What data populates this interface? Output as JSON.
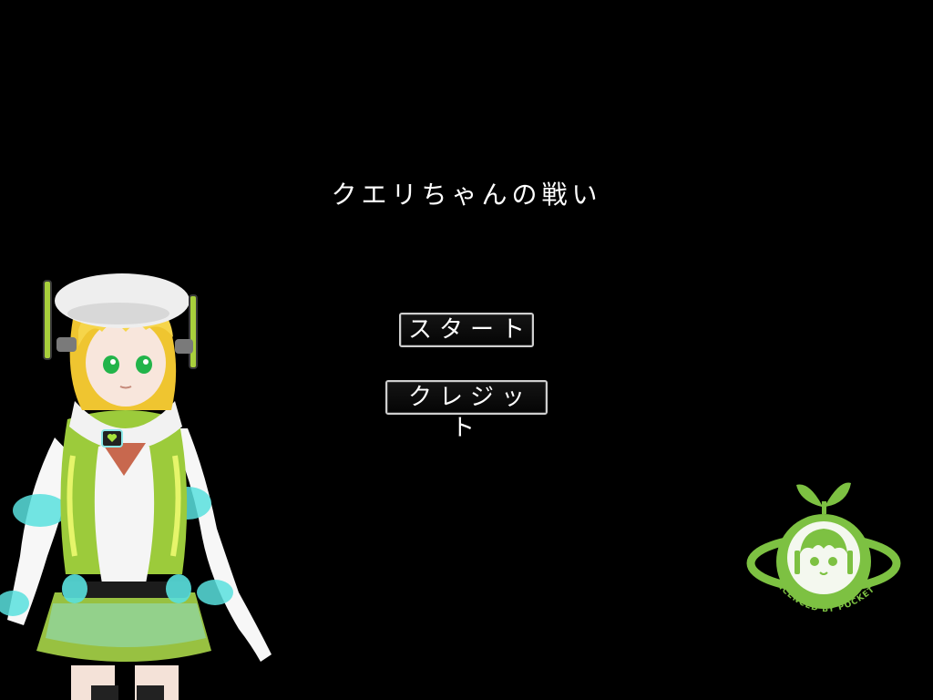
{
  "game": {
    "title": "クエリちゃんの戦い"
  },
  "menu": {
    "start_label": "スタート",
    "credit_label": "クレジット"
  },
  "logo": {
    "text": "LICENCED BY POCKET QUERIES",
    "color": "#7dc142"
  },
  "character": {
    "hair_color": "#f6d54a",
    "outfit_color": "#9ccb3b",
    "accent_color": "#5fe6e6"
  },
  "colors": {
    "background": "#000000",
    "text": "#ffffff",
    "button_border": "#cfcfcf"
  }
}
